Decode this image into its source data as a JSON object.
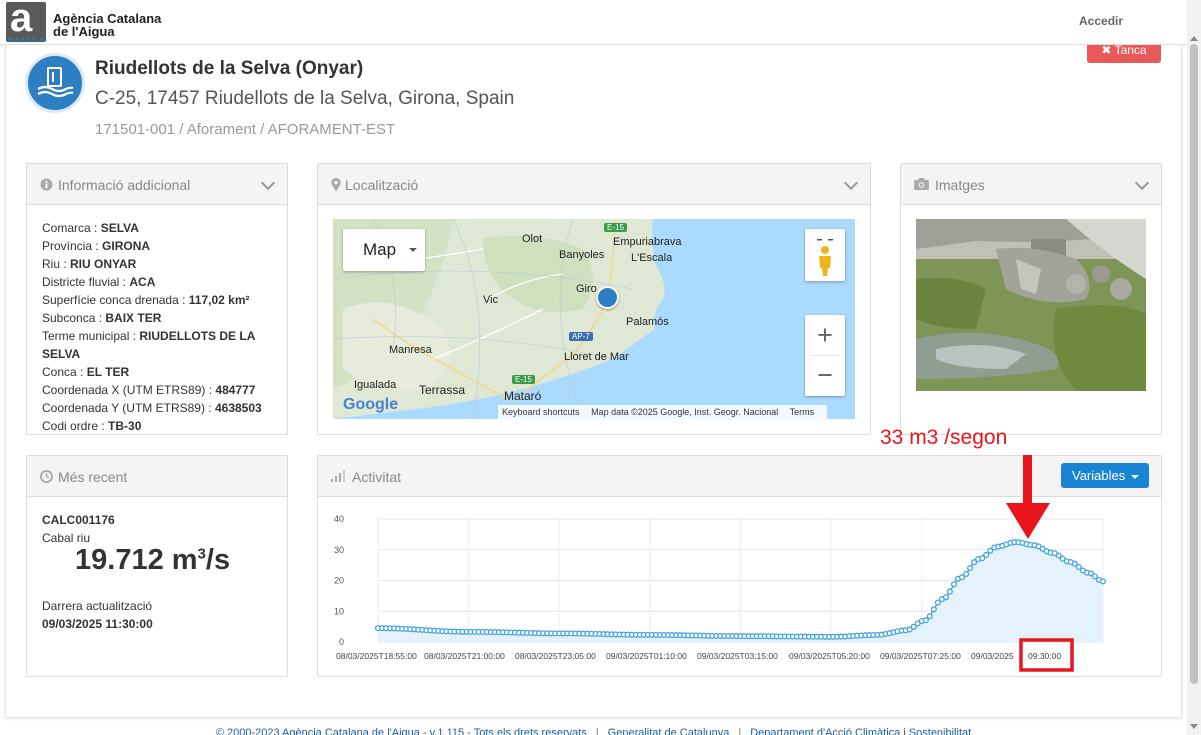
{
  "header": {
    "brand_line1": "Agència Catalana",
    "brand_line2": "de l'Aigua",
    "login": "Accedir"
  },
  "station": {
    "name": "Riudellots de la Selva (Onyar)",
    "address": "C-25, 17457 Riudellots de la Selva, Girona, Spain",
    "code": "171501-001 / Aforament / AFORAMENT-EST",
    "close_label": "✖ Tanca"
  },
  "info_panel": {
    "title": "Informació addicional",
    "rows": [
      {
        "label": "Comarca : ",
        "value": "SELVA"
      },
      {
        "label": "Província : ",
        "value": "GIRONA"
      },
      {
        "label": "Riu : ",
        "value": "RIU ONYAR"
      },
      {
        "label": "Districte fluvial : ",
        "value": "ACA"
      },
      {
        "label": "Superfície conca drenada : ",
        "value": "117,02 km²"
      },
      {
        "label": "Subconca : ",
        "value": "BAIX TER"
      },
      {
        "label": "Terme municipal : ",
        "value": "RIUDELLOTS DE LA SELVA"
      },
      {
        "label": "Conca : ",
        "value": "EL TER"
      },
      {
        "label": "Coordenada X (UTM ETRS89) : ",
        "value": "484777"
      },
      {
        "label": "Coordenada Y (UTM ETRS89) : ",
        "value": "4638503"
      },
      {
        "label": "Codi ordre : ",
        "value": "TB-30"
      }
    ]
  },
  "map_panel": {
    "title": "Localització",
    "map_type": "Map",
    "places": [
      "Olot",
      "Empuriabrava",
      "Banyoles",
      "L'Escala",
      "Giro",
      "Vic",
      "Palamós",
      "Manresa",
      "Lloret de Mar",
      "Igualada",
      "Terrassa",
      "Mataró"
    ],
    "road_labels": [
      "E-15",
      "AP-7",
      "E-15"
    ],
    "zoom_in": "+",
    "zoom_out": "−",
    "attribution": {
      "logo": "Google",
      "shortcuts": "Keyboard shortcuts",
      "data": "Map data ©2025 Google, Inst. Geogr. Nacional",
      "terms": "Terms"
    }
  },
  "images_panel": {
    "title": "Imatges"
  },
  "recent_panel": {
    "title": "Més recent",
    "code": "CALC001176",
    "variable": "Cabal riu",
    "value": "19.712 m",
    "unit_exp": "3",
    "unit_tail": "/s",
    "updated_label": "Darrera actualització",
    "updated_date": "09/03/2025 11:30:00"
  },
  "activity_panel": {
    "title": "Activitat",
    "variables_button": "Variables"
  },
  "chart_data": {
    "type": "area",
    "yticks": [
      "0",
      "10",
      "20",
      "30",
      "40"
    ],
    "ylim": [
      0,
      40
    ],
    "xtick_labels": [
      "08/03/2025T18:55:00",
      "08/03/2025T21:00:00",
      "08/03/2025T23:05:00",
      "09/03/2025T01:10:00",
      "09/03/2025T03:15:00",
      "09/03/2025T05:20:00",
      "09/03/2025T07:25:00",
      "09/03/2025",
      "09:30:00"
    ],
    "series": [
      {
        "color": "#3fa3db",
        "fill": "#e6f2fb",
        "x": [
          "08/03/2025 18:55",
          "08/03/2025 21:00",
          "08/03/2025 23:05",
          "09/03/2025 01:10",
          "09/03/2025 03:15",
          "09/03/2025 05:20",
          "09/03/2025 06:20",
          "09/03/2025 07:00",
          "09/03/2025 07:25",
          "09/03/2025 07:50",
          "09/03/2025 08:15",
          "09/03/2025 08:40",
          "09/03/2025 09:05",
          "09/03/2025 09:30",
          "09/03/2025 09:55",
          "09/03/2025 10:20",
          "09/03/2025 10:45",
          "09/03/2025 11:10",
          "09/03/2025 11:30"
        ],
        "values": [
          4.5,
          3.3,
          2.8,
          2.3,
          1.9,
          1.7,
          2.3,
          3.8,
          7,
          14,
          21,
          27,
          31,
          32.5,
          31.5,
          29,
          26,
          22.5,
          19.7
        ]
      }
    ],
    "grid": true
  },
  "annotations": {
    "callout": "33 m3 /segon",
    "color": "#e8161c"
  },
  "footer": {
    "copyright": "© 2000-2023 Agència Catalana de l'Aigua - v.1.115 - Tots els drets reservats",
    "link1": "Generalitat de Catalunya",
    "link2": "Departament d'Acció Climàtica i Sostenibilitat"
  }
}
